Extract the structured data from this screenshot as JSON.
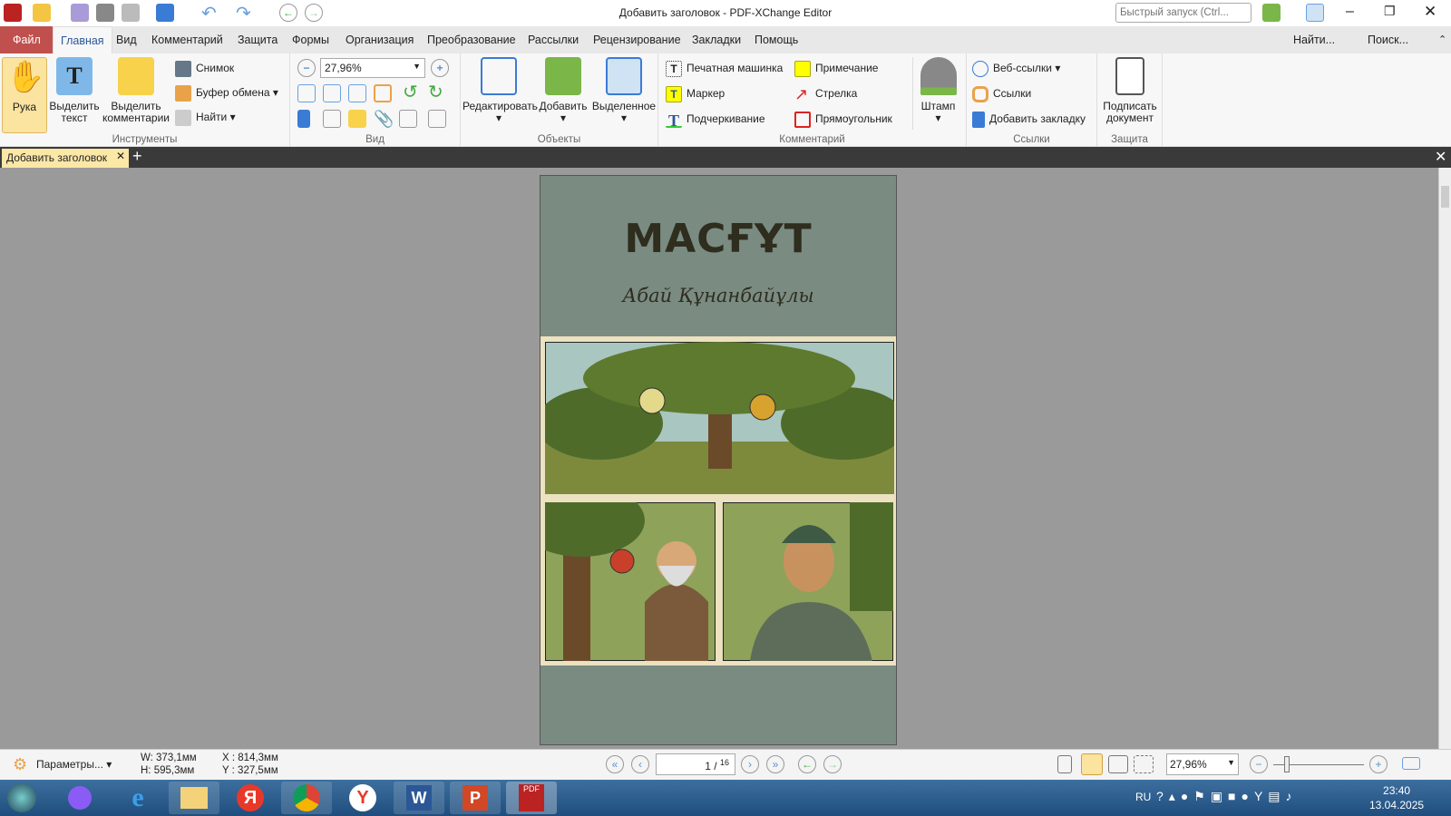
{
  "window": {
    "title": "Добавить заголовок - PDF-XChange Editor",
    "quick_launch_placeholder": "Быстрый запуск (Ctrl..."
  },
  "menu": {
    "tabs": [
      "Файл",
      "Главная",
      "Вид",
      "Комментарий",
      "Защита",
      "Формы",
      "Организация",
      "Преобразование",
      "Рассылки",
      "Рецензирование",
      "Закладки",
      "Помощь"
    ],
    "find": "Найти...",
    "search": "Поиск..."
  },
  "ribbon": {
    "tools": {
      "label": "Инструменты",
      "hand": "Рука",
      "select_text": "Выделить текст",
      "select_comments": "Выделить комментарии",
      "snapshot": "Снимок",
      "clipboard": "Буфер обмена",
      "find": "Найти"
    },
    "view": {
      "label": "Вид",
      "zoom": "27,96%"
    },
    "objects": {
      "label": "Объекты",
      "edit": "Редактировать",
      "add": "Добавить",
      "selected": "Выделенное"
    },
    "comments": {
      "label": "Комментарий",
      "typewriter": "Печатная машинка",
      "note": "Примечание",
      "marker": "Маркер",
      "arrow": "Стрелка",
      "underline": "Подчеркивание",
      "rectangle": "Прямоугольник",
      "stamp": "Штамп"
    },
    "links": {
      "label": "Ссылки",
      "web_links": "Веб-ссылки",
      "links": "Ссылки",
      "add_bookmark": "Добавить закладку"
    },
    "protect": {
      "label": "Защита",
      "sign": "Подписать документ"
    }
  },
  "doc_tab": {
    "name": "Добавить заголовок"
  },
  "page": {
    "title": "МАСҒҰТ",
    "author": "Абай Құнанбайұлы",
    "bg": "#7a8b82"
  },
  "status": {
    "params": "Параметры...",
    "w": "W: 373,1мм",
    "h": "H: 595,3мм",
    "x": "X : 814,3мм",
    "y": "Y : 327,5мм",
    "page_current": "1",
    "page_total": "16",
    "zoom": "27,96%"
  },
  "taskbar": {
    "lang": "RU",
    "time": "23:40",
    "date": "13.04.2025"
  }
}
